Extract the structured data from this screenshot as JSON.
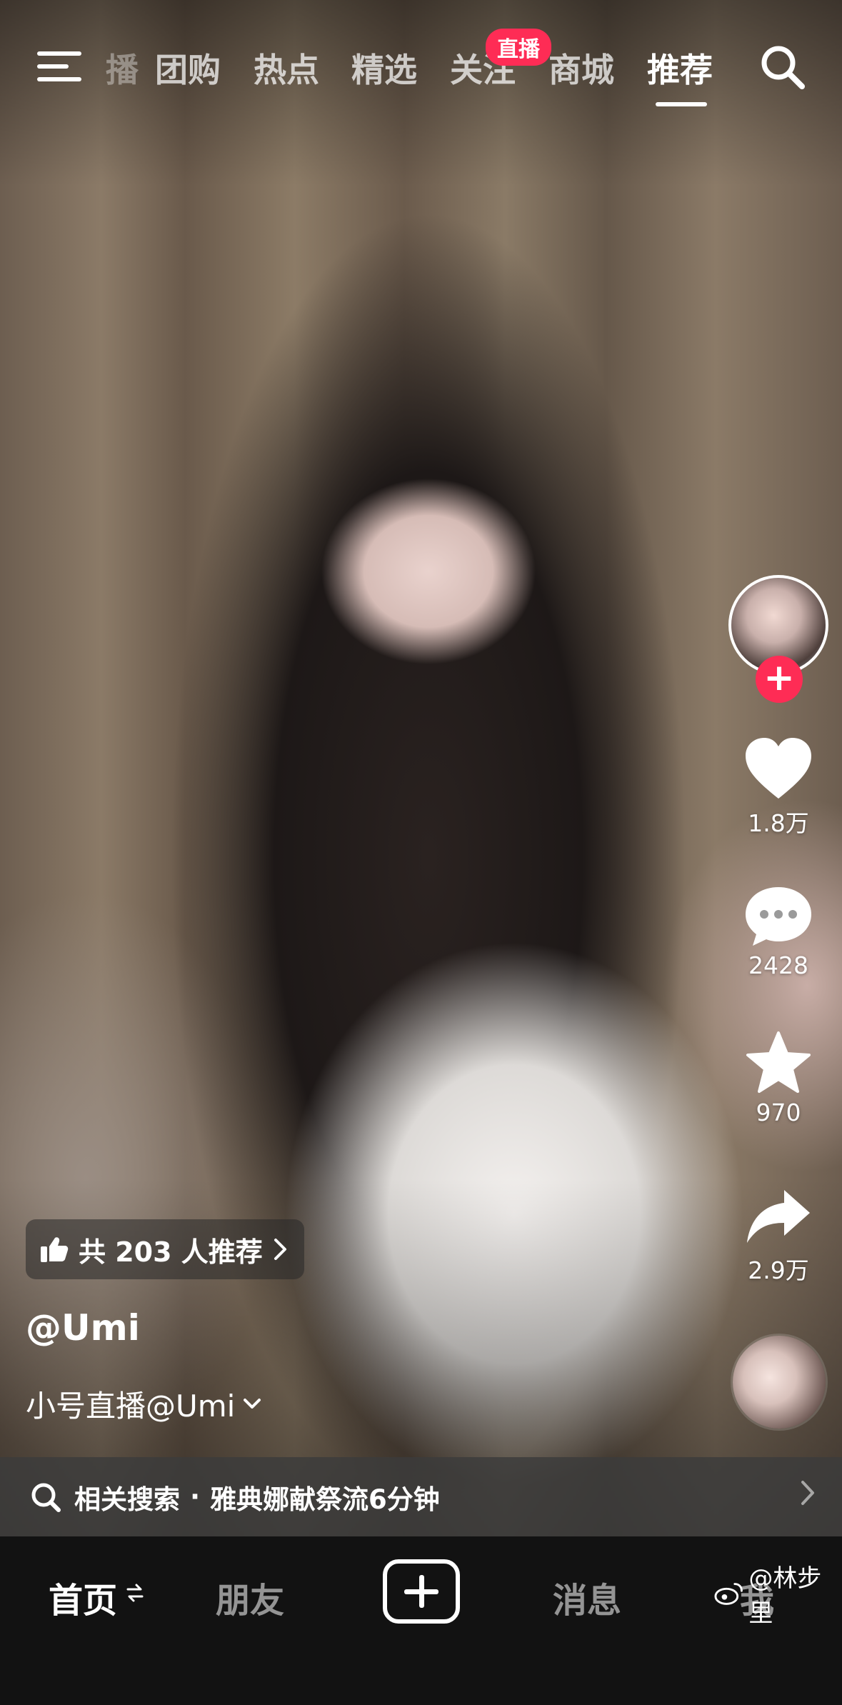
{
  "top_nav": {
    "partial_tab": "播",
    "tabs": [
      {
        "label": "团购"
      },
      {
        "label": "热点"
      },
      {
        "label": "精选"
      },
      {
        "label": "关注"
      },
      {
        "label": "商城"
      },
      {
        "label": "推荐"
      }
    ],
    "active_tab": "推荐",
    "live_badge": "直播"
  },
  "creator": {
    "username": "@Umi",
    "caption": "小号直播@Umi"
  },
  "recommend_chip": {
    "text": "共 203 人推荐"
  },
  "actions": {
    "likes": "1.8万",
    "comments": "2428",
    "favorites": "970",
    "shares": "2.9万"
  },
  "related_search": {
    "prefix": "相关搜索",
    "separator": "·",
    "query": "雅典娜献祭流6分钟"
  },
  "bottom_nav": {
    "items": [
      {
        "label": "首页"
      },
      {
        "label": "朋友"
      },
      {
        "label": "消息"
      },
      {
        "label": "我"
      }
    ]
  },
  "watermark": "@林步里",
  "colors": {
    "accent": "#fe2c55",
    "nav_bg": "#121212"
  },
  "icons": [
    "menu-icon",
    "search-icon",
    "heart-icon",
    "comment-icon",
    "star-icon",
    "share-icon",
    "thumbs-up-icon",
    "chevron-right-icon",
    "chevron-down-icon",
    "plus-icon",
    "weibo-icon"
  ]
}
